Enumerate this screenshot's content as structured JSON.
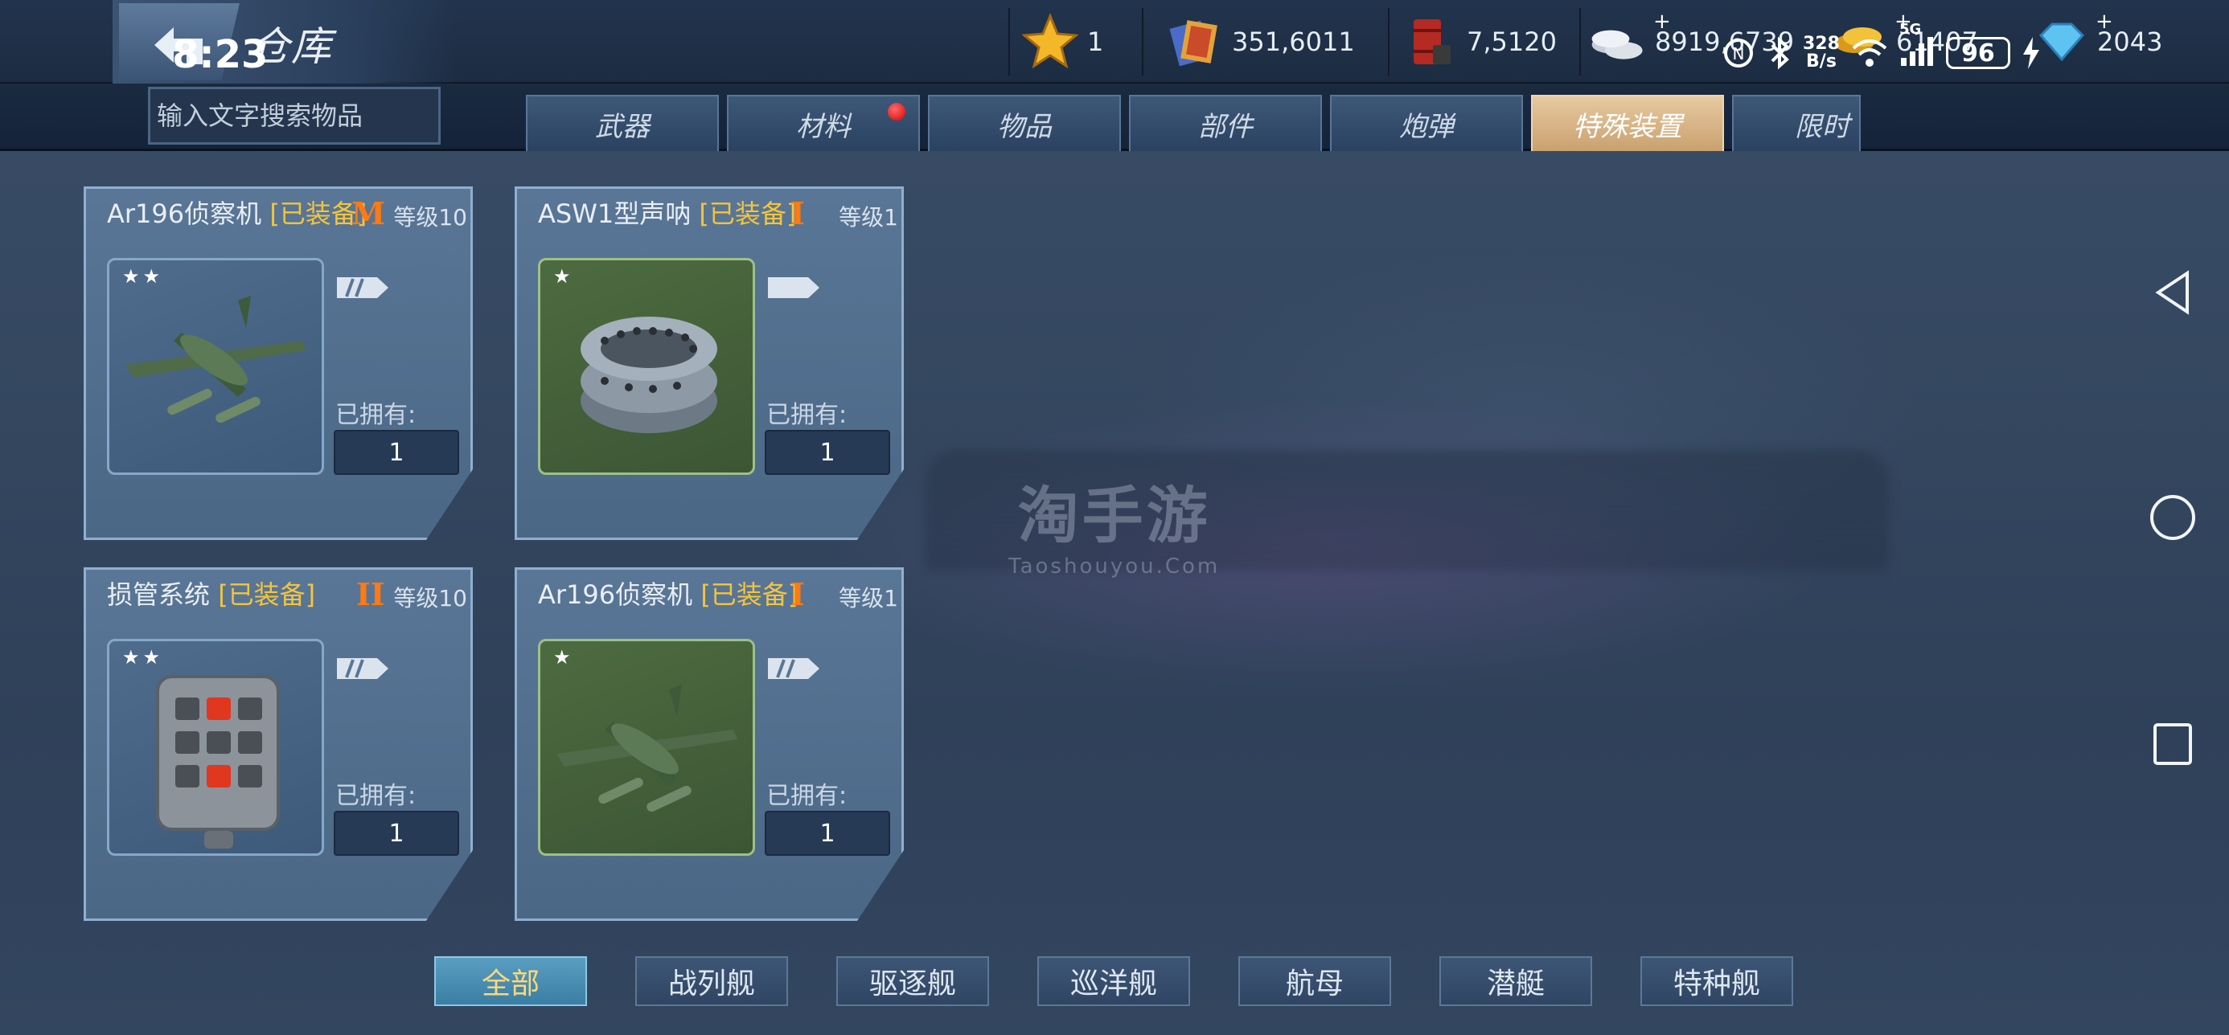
{
  "status_bar": {
    "time": "8:23",
    "net_speed_line1": "328",
    "net_speed_line2": "B/s",
    "signal_label": "5G",
    "battery": "96"
  },
  "header": {
    "title": "仓库"
  },
  "currencies": [
    {
      "icon": "star-icon",
      "value": "1",
      "has_plus": false
    },
    {
      "icon": "book-icon",
      "value": "351,6011",
      "has_plus": false
    },
    {
      "icon": "oil-barrel-icon",
      "value": "7,5120",
      "has_plus": false
    },
    {
      "icon": "silver-coins-icon",
      "value": "8919,6739",
      "has_plus": true
    },
    {
      "icon": "gold-coins-icon",
      "value": "61407",
      "has_plus": true
    },
    {
      "icon": "diamond-icon",
      "value": "2043",
      "has_plus": true
    }
  ],
  "search": {
    "placeholder": "输入文字搜索物品"
  },
  "tabs": [
    {
      "label": "武器",
      "active": false,
      "badge": false
    },
    {
      "label": "材料",
      "active": false,
      "badge": true
    },
    {
      "label": "物品",
      "active": false,
      "badge": false
    },
    {
      "label": "部件",
      "active": false,
      "badge": false
    },
    {
      "label": "炮弹",
      "active": false,
      "badge": false
    },
    {
      "label": "特殊装置",
      "active": true,
      "badge": false
    },
    {
      "label": "限时",
      "active": false,
      "badge": false
    }
  ],
  "items": [
    {
      "name": "Ar196侦察机",
      "equipped_tag": "[已装备]",
      "rank": "M",
      "level_label": "等级10",
      "stars": "★★",
      "owned_label": "已拥有:",
      "owned": "1",
      "thumb": "seaplane-icon"
    },
    {
      "name": "ASW1型声呐",
      "equipped_tag": "[已装备]",
      "rank": "I",
      "level_label": "等级1",
      "stars": "★",
      "owned_label": "已拥有:",
      "owned": "1",
      "thumb": "sonar-icon"
    },
    {
      "name": "损管系统",
      "equipped_tag": "[已装备]",
      "rank": "II",
      "level_label": "等级10",
      "stars": "★★",
      "owned_label": "已拥有:",
      "owned": "1",
      "thumb": "damage-control-icon"
    },
    {
      "name": "Ar196侦察机",
      "equipped_tag": "[已装备]",
      "rank": "I",
      "level_label": "等级1",
      "stars": "★",
      "owned_label": "已拥有:",
      "owned": "1",
      "thumb": "seaplane-icon"
    }
  ],
  "filters": [
    {
      "label": "全部",
      "active": true
    },
    {
      "label": "战列舰",
      "active": false
    },
    {
      "label": "驱逐舰",
      "active": false
    },
    {
      "label": "巡洋舰",
      "active": false
    },
    {
      "label": "航母",
      "active": false
    },
    {
      "label": "潜艇",
      "active": false
    },
    {
      "label": "特种舰",
      "active": false
    }
  ],
  "watermark": {
    "title": "淘手游",
    "subtitle": "Taoshouyou.Com"
  },
  "colors": {
    "accent_tab": "#c9a170",
    "equipped_text": "#f3c53c",
    "rank_text": "#ff7a10",
    "active_filter": "#3a7ea3"
  }
}
